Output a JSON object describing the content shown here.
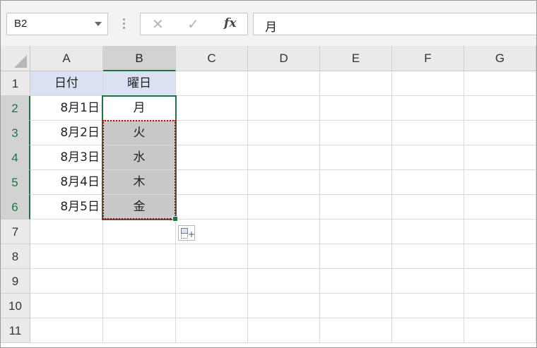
{
  "formula_bar": {
    "name_box": "B2",
    "cancel_glyph": "✕",
    "enter_glyph": "✓",
    "fx_label": "fx",
    "formula": "月"
  },
  "columns": [
    "A",
    "B",
    "C",
    "D",
    "E",
    "F",
    "G"
  ],
  "rows": [
    "1",
    "2",
    "3",
    "4",
    "5",
    "6",
    "7",
    "8",
    "9",
    "10",
    "11"
  ],
  "cells": {
    "A1": "日付",
    "B1": "曜日",
    "A2": "8月1日",
    "A3": "8月2日",
    "A4": "8月3日",
    "A5": "8月4日",
    "A6": "8月5日",
    "B2": "月",
    "B3": "火",
    "B4": "水",
    "B5": "木",
    "B6": "金"
  },
  "selection": {
    "active_cell": "B2",
    "range": "B2:B6",
    "copied_range": "B3:B6"
  },
  "colors": {
    "header_fill": "#d9e1f2",
    "filled_cells": "#c8c8c8",
    "selection_border": "#217346",
    "copy_marquee": "#c00000"
  },
  "icons": {
    "auto_fill_options": "auto-fill-options-icon",
    "name_box_dropdown": "chevron-down-icon"
  }
}
